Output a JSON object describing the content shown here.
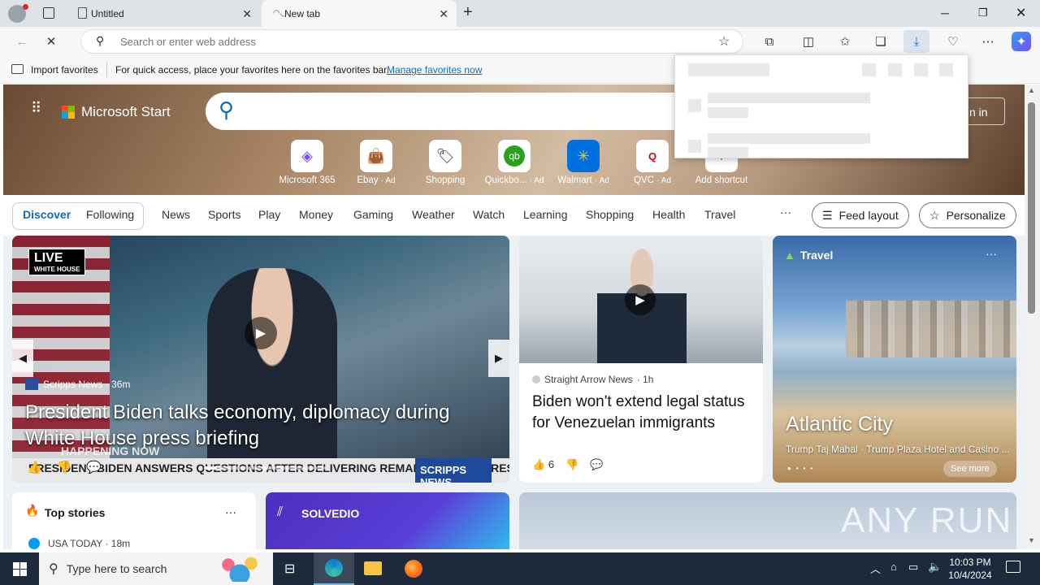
{
  "browser": {
    "tabs": [
      {
        "title": "Untitled"
      },
      {
        "title": "New tab"
      }
    ],
    "address_placeholder": "Search or enter web address",
    "favorites_bar": {
      "import_label": "Import favorites",
      "hint": "For quick access, place your favorites here on the favorites bar.",
      "manage_link": "Manage favorites now"
    }
  },
  "page": {
    "brand": "Microsoft Start",
    "sign_in": "n in",
    "shortcuts": [
      {
        "label": "Microsoft 365",
        "ad": ""
      },
      {
        "label": "Ebay",
        "ad": "· Ad"
      },
      {
        "label": "Shopping",
        "ad": ""
      },
      {
        "label": "Quickbo...",
        "ad": "· Ad"
      },
      {
        "label": "Walmart",
        "ad": "· Ad"
      },
      {
        "label": "QVC",
        "ad": "· Ad"
      },
      {
        "label": "Add shortcut",
        "ad": ""
      }
    ],
    "nav": {
      "discover": "Discover",
      "following": "Following",
      "items": [
        "News",
        "Sports",
        "Play",
        "Money",
        "Gaming",
        "Weather",
        "Watch",
        "Learning",
        "Shopping",
        "Health",
        "Travel"
      ],
      "more": "···",
      "feed_layout": "Feed layout",
      "personalize": "Personalize"
    },
    "hero_card": {
      "live": "LIVE",
      "live_sub": "WHITE HOUSE",
      "source": "Scripps News · 36m",
      "title": "President Biden talks economy, diplomacy during White House press briefing",
      "banner": "PRESIDENT BIDEN ANSWERS QUESTIONS AFTER DELIVERING REMARKS AT THE PRESS BRIEFING",
      "banner_tag": "SCRIPPS NEWS",
      "happening": "HAPPENING NOW"
    },
    "news_card": {
      "source": "Straight Arrow News",
      "time": "· 1h",
      "title": "Biden won't extend legal status for Venezuelan immigrants",
      "likes": "6"
    },
    "travel_card": {
      "category": "Travel",
      "title": "Atlantic City",
      "subtitle": "Trump Taj Mahal · Trump Plaza Hotel and Casino ...",
      "see_more": "See more"
    },
    "top_stories": {
      "title": "Top stories",
      "first_source": "USA TODAY · 18m"
    },
    "solvedio": {
      "label": "SOLVEDIO"
    },
    "watermark": "ANY RUN"
  },
  "taskbar": {
    "search_placeholder": "Type here to search",
    "time": "10:03 PM",
    "date": "10/4/2024"
  },
  "colors": {
    "accent": "#0f6cbd",
    "taskbar": "#1c2a3c"
  }
}
